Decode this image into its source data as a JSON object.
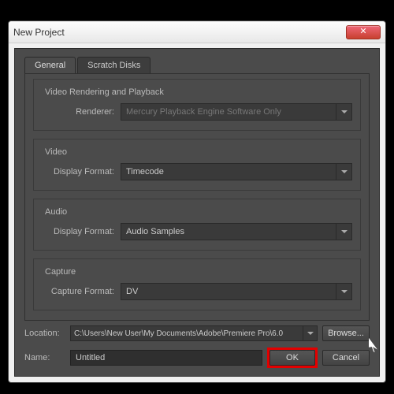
{
  "window": {
    "title": "New Project"
  },
  "tabs": {
    "general": "General",
    "scratch": "Scratch Disks"
  },
  "groups": {
    "render": {
      "title": "Video Rendering and Playback",
      "renderer_label": "Renderer:",
      "renderer_value": "Mercury Playback Engine Software Only"
    },
    "video": {
      "title": "Video",
      "format_label": "Display Format:",
      "format_value": "Timecode"
    },
    "audio": {
      "title": "Audio",
      "format_label": "Display Format:",
      "format_value": "Audio Samples"
    },
    "capture": {
      "title": "Capture",
      "format_label": "Capture Format:",
      "format_value": "DV"
    }
  },
  "location": {
    "label": "Location:",
    "path": "C:\\Users\\New User\\My Documents\\Adobe\\Premiere Pro\\6.0",
    "browse": "Browse..."
  },
  "name": {
    "label": "Name:",
    "value": "Untitled"
  },
  "buttons": {
    "ok": "OK",
    "cancel": "Cancel"
  },
  "colors": {
    "highlight": "#e30000",
    "panel": "#4b4b4b"
  }
}
